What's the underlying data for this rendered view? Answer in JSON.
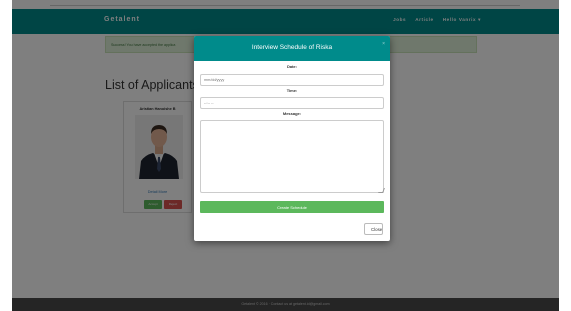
{
  "navbar": {
    "brand": "Getalent",
    "links": [
      "Jobs",
      "Article",
      "Hello Vanrix ▾"
    ]
  },
  "alert": {
    "text": "Success! You have accepted the applica"
  },
  "main": {
    "title": "List of Applicants",
    "applicant": {
      "name": "Aristian Hanoishe B",
      "link": "Detail More",
      "accept_label": "Accept",
      "reject_label": "Reject"
    }
  },
  "footer": {
    "text": "Getalent © 2016 · Contact us at getalent.id@gmail.com"
  },
  "modal": {
    "title": "Interview Schedule of Riska",
    "close_x": "×",
    "date_label": "Date:",
    "date_placeholder": "mm/dd/yyyy",
    "time_label": "Time:",
    "time_placeholder": "--:-- --",
    "message_label": "Message:",
    "create_label": "Create Schedule",
    "close_label": "Close"
  },
  "colors": {
    "primary": "#008b8b",
    "success": "#5cb85c",
    "danger": "#d9534f"
  }
}
